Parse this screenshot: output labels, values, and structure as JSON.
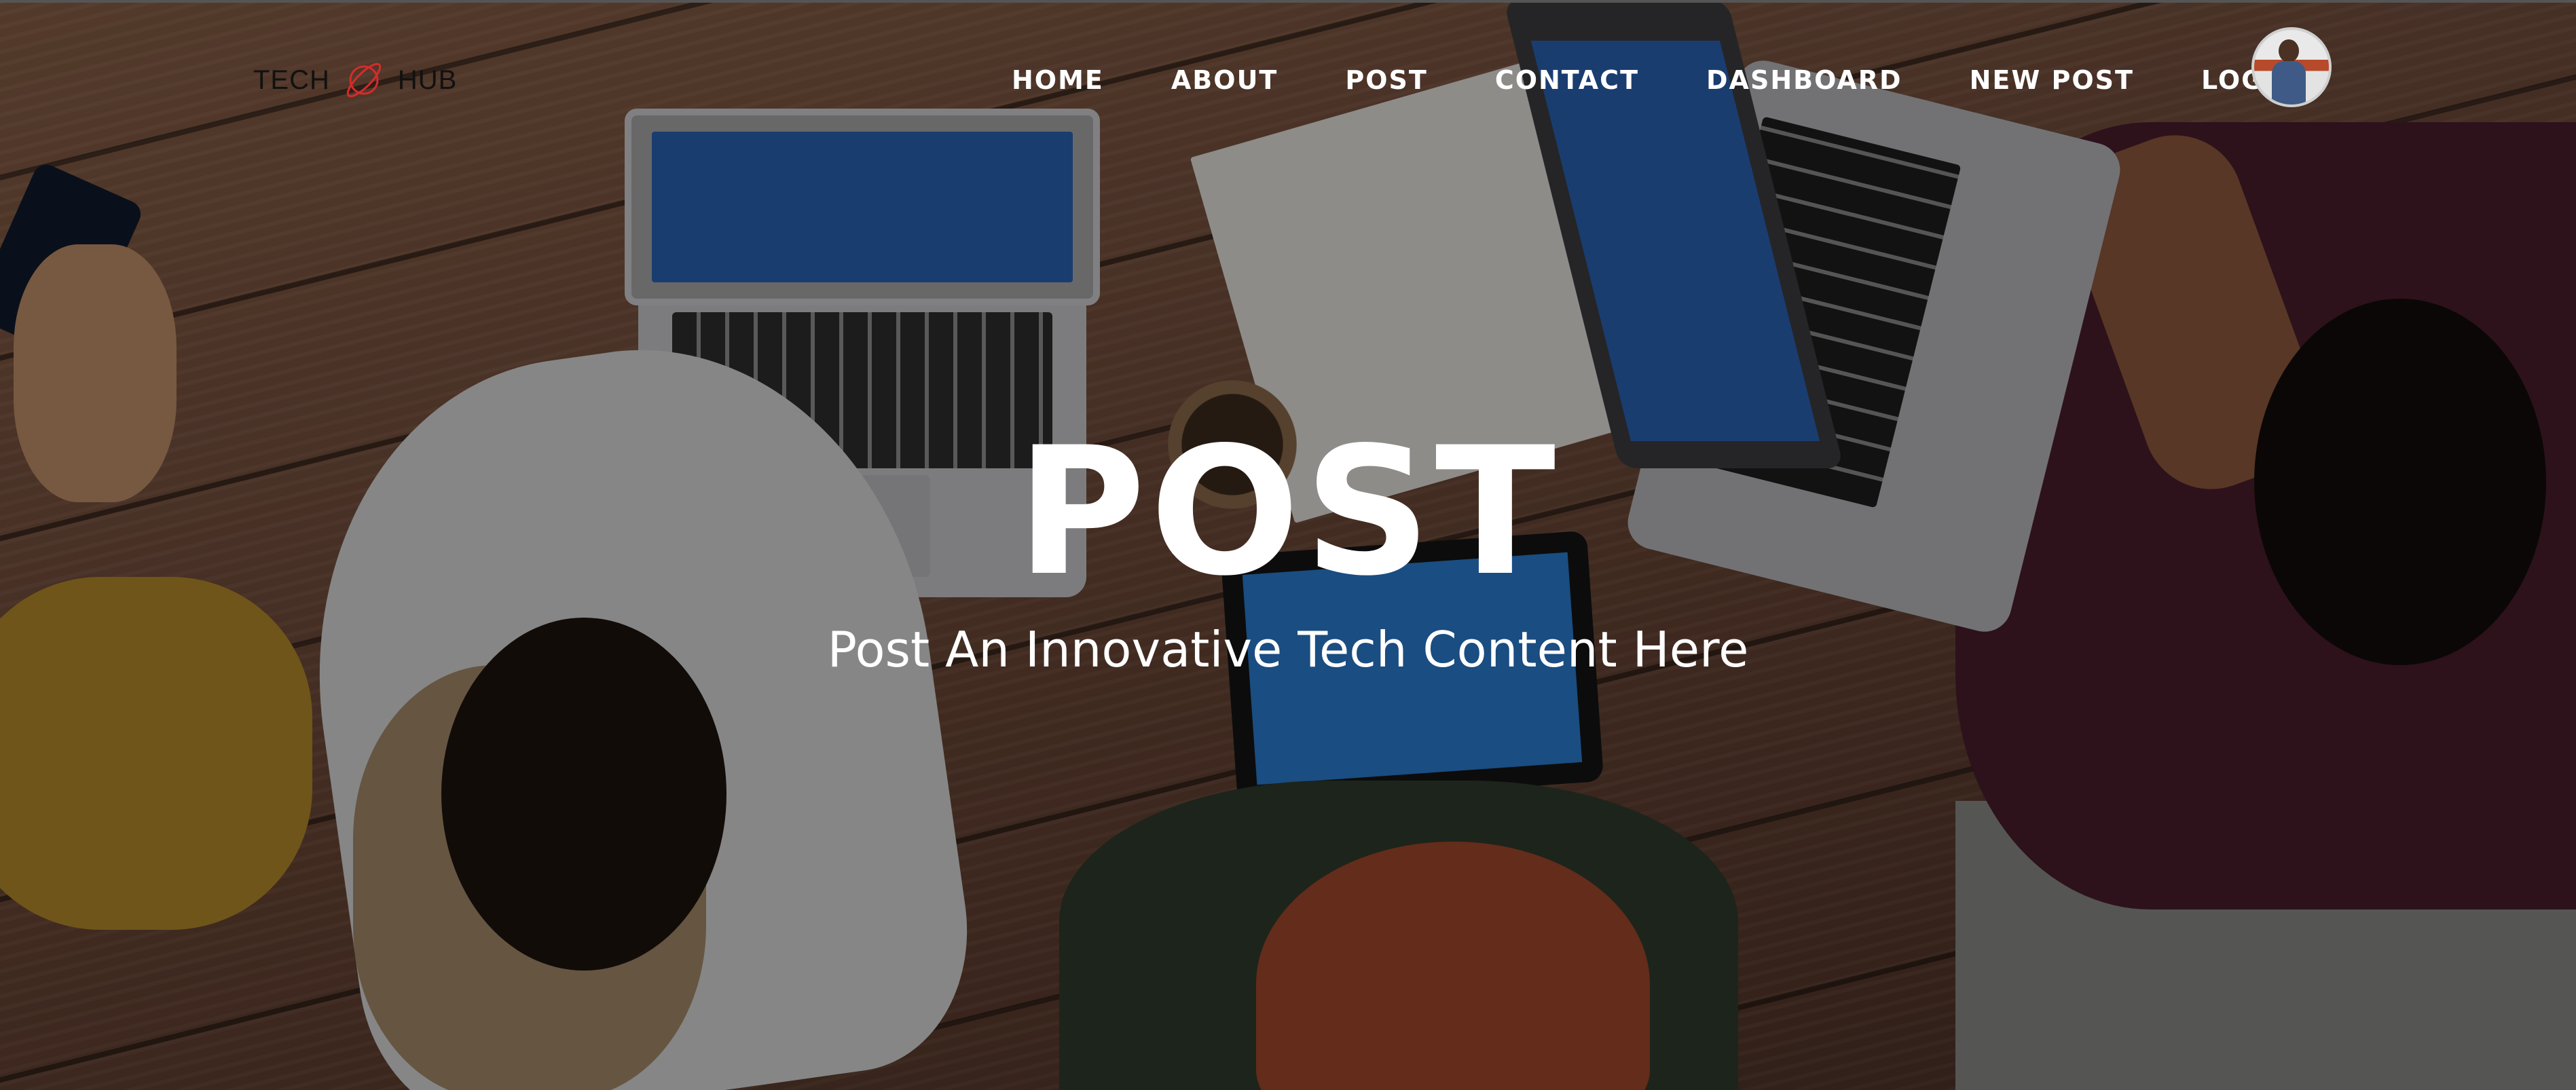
{
  "brand": {
    "left_word": "TECH",
    "right_word": "HUB",
    "icon": "planet-orbit-icon",
    "accent_color": "#d62b2b"
  },
  "nav": {
    "items": [
      {
        "label": "HOME"
      },
      {
        "label": "ABOUT"
      },
      {
        "label": "POST"
      },
      {
        "label": "CONTACT"
      },
      {
        "label": "DASHBOARD"
      },
      {
        "label": "NEW POST"
      },
      {
        "label": "LOGOUT"
      }
    ],
    "avatar_icon": "user-avatar-icon"
  },
  "hero": {
    "title": "POST",
    "subtitle": "Post An Innovative Tech Content Here"
  }
}
